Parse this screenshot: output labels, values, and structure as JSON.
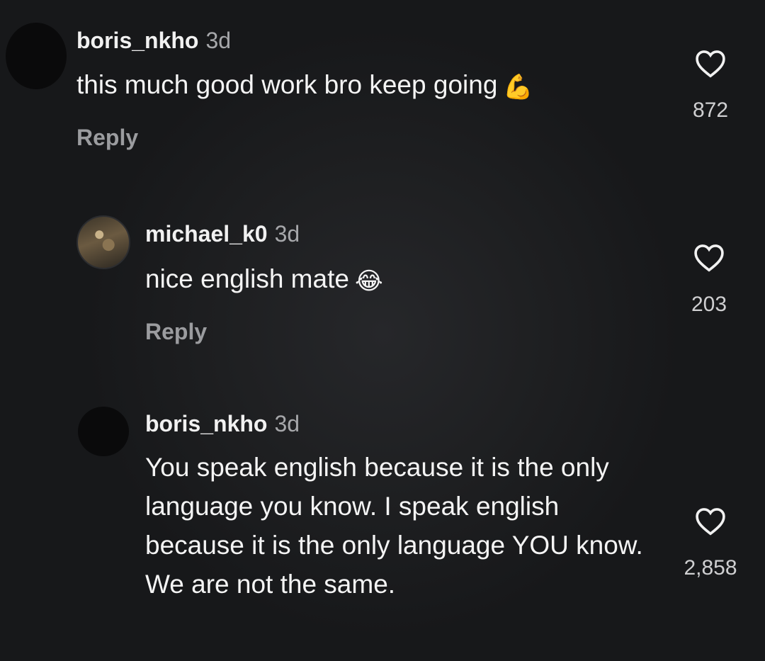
{
  "comments": [
    {
      "username": "boris_nkho",
      "time": "3d",
      "text": "this much good work bro keep going",
      "emoji": "💪",
      "reply_label": "Reply",
      "likes": "872"
    },
    {
      "username": "michael_k0",
      "time": "3d",
      "text": "nice english mate",
      "emoji": "😂",
      "reply_label": "Reply",
      "likes": "203"
    },
    {
      "username": "boris_nkho",
      "time": "3d",
      "text": "You speak english because it is the only language you know. I speak english because it is the only language YOU know. We are not the same.",
      "likes": "2,858"
    }
  ],
  "icons": {
    "like": "heart-outline-icon",
    "avatar_empty": "dark-circle-avatar",
    "avatar_photo": "photo-avatar"
  },
  "colors": {
    "background": "#17181a",
    "text": "#f4f4f4",
    "secondary": "#a6a7aa",
    "reply": "#9b9c9f"
  }
}
